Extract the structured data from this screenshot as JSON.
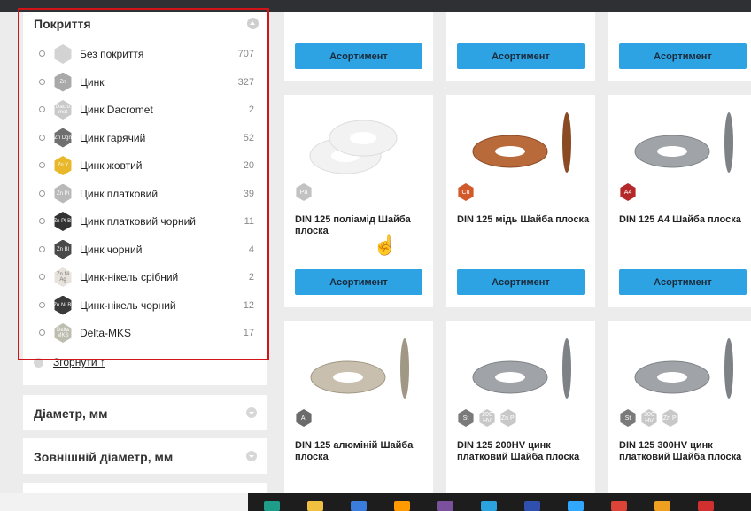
{
  "sidebar": {
    "coating_title": "Покриття",
    "collapse_label": "Згорнути ↑",
    "items": [
      {
        "label": "Без покриття",
        "count": "707",
        "icon_text": "",
        "color": "#d3d3d3"
      },
      {
        "label": "Цинк",
        "count": "327",
        "icon_text": "Zn",
        "color": "#a9a9a9"
      },
      {
        "label": "Цинк Dacromet",
        "count": "2",
        "icon_text": "Dacro met",
        "color": "#c9c9c9"
      },
      {
        "label": "Цинк гарячий",
        "count": "52",
        "icon_text": "Zn Dgn",
        "color": "#6f6f6f"
      },
      {
        "label": "Цинк жовтий",
        "count": "20",
        "icon_text": "Zn Y",
        "color": "#e9b82a"
      },
      {
        "label": "Цинк платковий",
        "count": "39",
        "icon_text": "Zn Pl",
        "color": "#b9b9b9"
      },
      {
        "label": "Цинк платковий чорний",
        "count": "11",
        "icon_text": "Zn Pl Bl",
        "color": "#333333"
      },
      {
        "label": "Цинк чорний",
        "count": "4",
        "icon_text": "Zn Bl",
        "color": "#4a4a4a"
      },
      {
        "label": "Цинк-нікель срібний",
        "count": "2",
        "icon_text": "Zn Ni Ag",
        "color": "#e8e2dc"
      },
      {
        "label": "Цинк-нікель чорний",
        "count": "12",
        "icon_text": "Zn Ni Bl",
        "color": "#3a3a3a"
      },
      {
        "label": "Delta-MKS",
        "count": "17",
        "icon_text": "Delta MKS",
        "color": "#bdbdb0"
      }
    ],
    "filters": [
      {
        "title": "Діаметр, мм"
      },
      {
        "title": "Зовнішній діаметр, мм"
      }
    ]
  },
  "products": {
    "button_label": "Асортимент",
    "row2": [
      {
        "title": "DIN 125 поліамід Шайба плоска",
        "badges": [
          {
            "text": "Pa",
            "color": "#c2c2c2"
          }
        ],
        "washer": "white"
      },
      {
        "title": "DIN 125 мідь Шайба плоска",
        "badges": [
          {
            "text": "Cu",
            "color": "#d2592a"
          }
        ],
        "washer": "copper"
      },
      {
        "title": "DIN 125 A4 Шайба плоска",
        "badges": [
          {
            "text": "A4",
            "color": "#b5282a"
          }
        ],
        "washer": "steel"
      }
    ],
    "row3": [
      {
        "title": "DIN 125 алюміній Шайба плоска",
        "badges": [
          {
            "text": "Al",
            "color": "#6b6b6b"
          }
        ],
        "washer": "alu"
      },
      {
        "title": "DIN 125 200HV цинк платковий Шайба плоска",
        "badges": [
          {
            "text": "St",
            "color": "#7a7a7a"
          },
          {
            "text": "200 HV",
            "color": "#c8c8c8"
          },
          {
            "text": "Zn Pl",
            "color": "#c8c8c8"
          }
        ],
        "washer": "steel"
      },
      {
        "title": "DIN 125 300HV цинк платковий Шайба плоска",
        "badges": [
          {
            "text": "St",
            "color": "#7a7a7a"
          },
          {
            "text": "300 HV",
            "color": "#c8c8c8"
          },
          {
            "text": "Zn Pl",
            "color": "#c8c8c8"
          }
        ],
        "washer": "steel"
      }
    ]
  },
  "taskbar": {
    "icons": [
      {
        "name": "edge-icon",
        "color": "#1e9e8a"
      },
      {
        "name": "folder-icon",
        "color": "#f0c040"
      },
      {
        "name": "app-icon",
        "color": "#3b7ddd"
      },
      {
        "name": "illustrator-icon",
        "color": "#ff9a00"
      },
      {
        "name": "viber-icon",
        "color": "#7b519d"
      },
      {
        "name": "telegram-icon",
        "color": "#2aa3de"
      },
      {
        "name": "app2-icon",
        "color": "#3050b0"
      },
      {
        "name": "photoshop-icon",
        "color": "#31a8ff"
      },
      {
        "name": "chrome-icon",
        "color": "#db4437"
      },
      {
        "name": "app3-icon",
        "color": "#f0a020"
      },
      {
        "name": "app4-icon",
        "color": "#d03030"
      }
    ]
  }
}
